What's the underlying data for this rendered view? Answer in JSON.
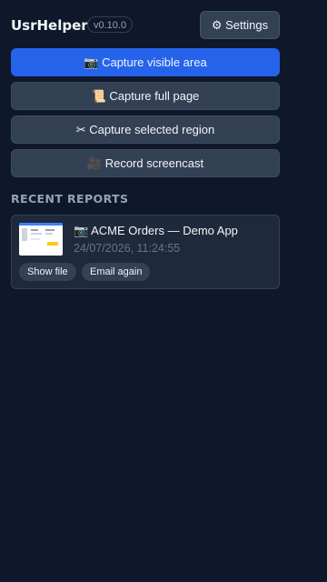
{
  "header": {
    "app_title": "UsrHelper",
    "version": "v0.10.0",
    "settings_label": "⚙ Settings"
  },
  "actions": [
    {
      "label": "📷 Capture visible area",
      "primary": true
    },
    {
      "label": "📜 Capture full page",
      "primary": false
    },
    {
      "label": "✂ Capture selected region",
      "primary": false
    },
    {
      "label": "🎥 Record screencast",
      "primary": false
    }
  ],
  "recent": {
    "section_title": "RECENT REPORTS",
    "reports": [
      {
        "title": "📷 ACME Orders — Demo App",
        "timestamp": "24/07/2026, 11:24:55",
        "show_file_label": "Show file",
        "email_again_label": "Email again"
      }
    ]
  },
  "colors": {
    "background": "#0f172a",
    "primary": "#2563eb",
    "button": "#334155",
    "card": "#1e293b"
  }
}
